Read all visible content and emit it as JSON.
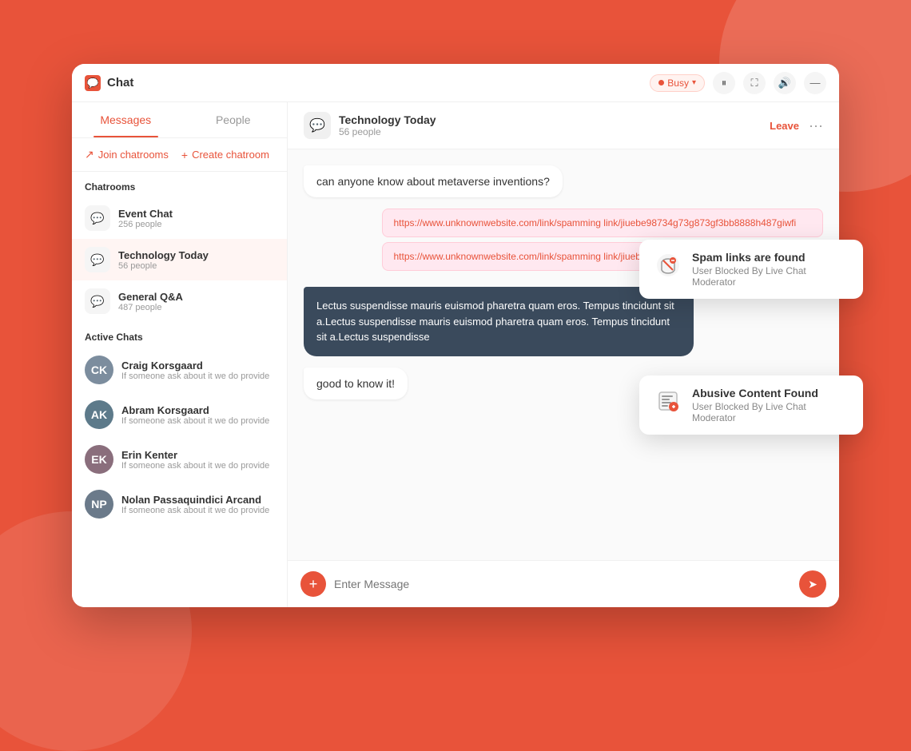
{
  "window": {
    "title": "Chat",
    "status": "Busy"
  },
  "tabs": {
    "messages_label": "Messages",
    "people_label": "People"
  },
  "sidebar": {
    "join_label": "Join chatrooms",
    "create_label": "Create chatroom",
    "chatrooms_section": "Chatrooms",
    "active_chats_section": "Active Chats",
    "chatrooms": [
      {
        "name": "Event Chat",
        "count": "256 people"
      },
      {
        "name": "Technology Today",
        "count": "56 people"
      },
      {
        "name": "General Q&A",
        "count": "487 people"
      }
    ],
    "active_chats": [
      {
        "name": "Craig Korsgaard",
        "status": "If someone ask about it we do provide",
        "initials": "CK"
      },
      {
        "name": "Abram Korsgaard",
        "status": "If someone ask about it we do provide",
        "initials": "AK"
      },
      {
        "name": "Erin Kenter",
        "status": "If someone ask about it we do provide",
        "initials": "EK"
      },
      {
        "name": "Nolan Passaquindici Arcand",
        "status": "If someone ask about it we do provide",
        "initials": "NP"
      }
    ]
  },
  "chat": {
    "room_name": "Technology Today",
    "room_people": "56 people",
    "leave_label": "Leave",
    "messages": [
      {
        "type": "left",
        "text": "can anyone know about metaverse inventions?"
      },
      {
        "type": "spam",
        "link1": "https://www.unknownwebsite.com/link/spamming link/jiuebe98734g73g873gf3bb8888h487giwfi",
        "link2": "https://www.unknownwebsite.com/link/spamming link/jiuebe98734g73g873gf3bb8888h487giwfi"
      },
      {
        "type": "dark",
        "text": "Lectus suspendisse mauris euismod pharetra quam eros. Tempus tincidunt sit a.Lectus suspendisse mauris euismod pharetra quam eros. Tempus tincidunt sit a.Lectus suspendisse"
      },
      {
        "type": "left",
        "text": "good to know it!"
      }
    ],
    "input_placeholder": "Enter Message"
  },
  "notifications": [
    {
      "title": "Spam links are found",
      "subtitle": "User Blocked By Live Chat Moderator",
      "icon": "🔗"
    },
    {
      "title": "Abusive Content Found",
      "subtitle": "User Blocked By Live Chat Moderator",
      "icon": "📋"
    }
  ]
}
